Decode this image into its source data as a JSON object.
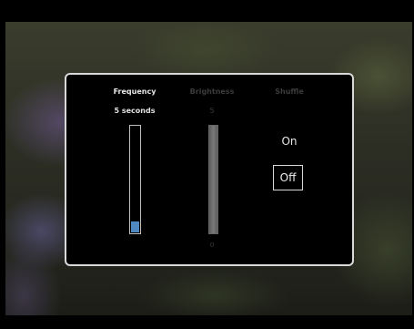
{
  "settings": {
    "frequency": {
      "label": "Frequency",
      "value_label": "5 seconds",
      "level": 0.1
    },
    "brightness": {
      "label": "Brightness",
      "max_label": "5",
      "min_label": "0",
      "level": 1.0
    },
    "shuffle": {
      "label": "Shuffle",
      "option_on": "On",
      "option_off": "Off",
      "selected": "Off"
    }
  },
  "colors": {
    "panel_border": "#d9d9d9",
    "active_text": "#e8e8e8",
    "inactive_text": "#3a3a3a",
    "slider_fill": "#4f88c0"
  }
}
